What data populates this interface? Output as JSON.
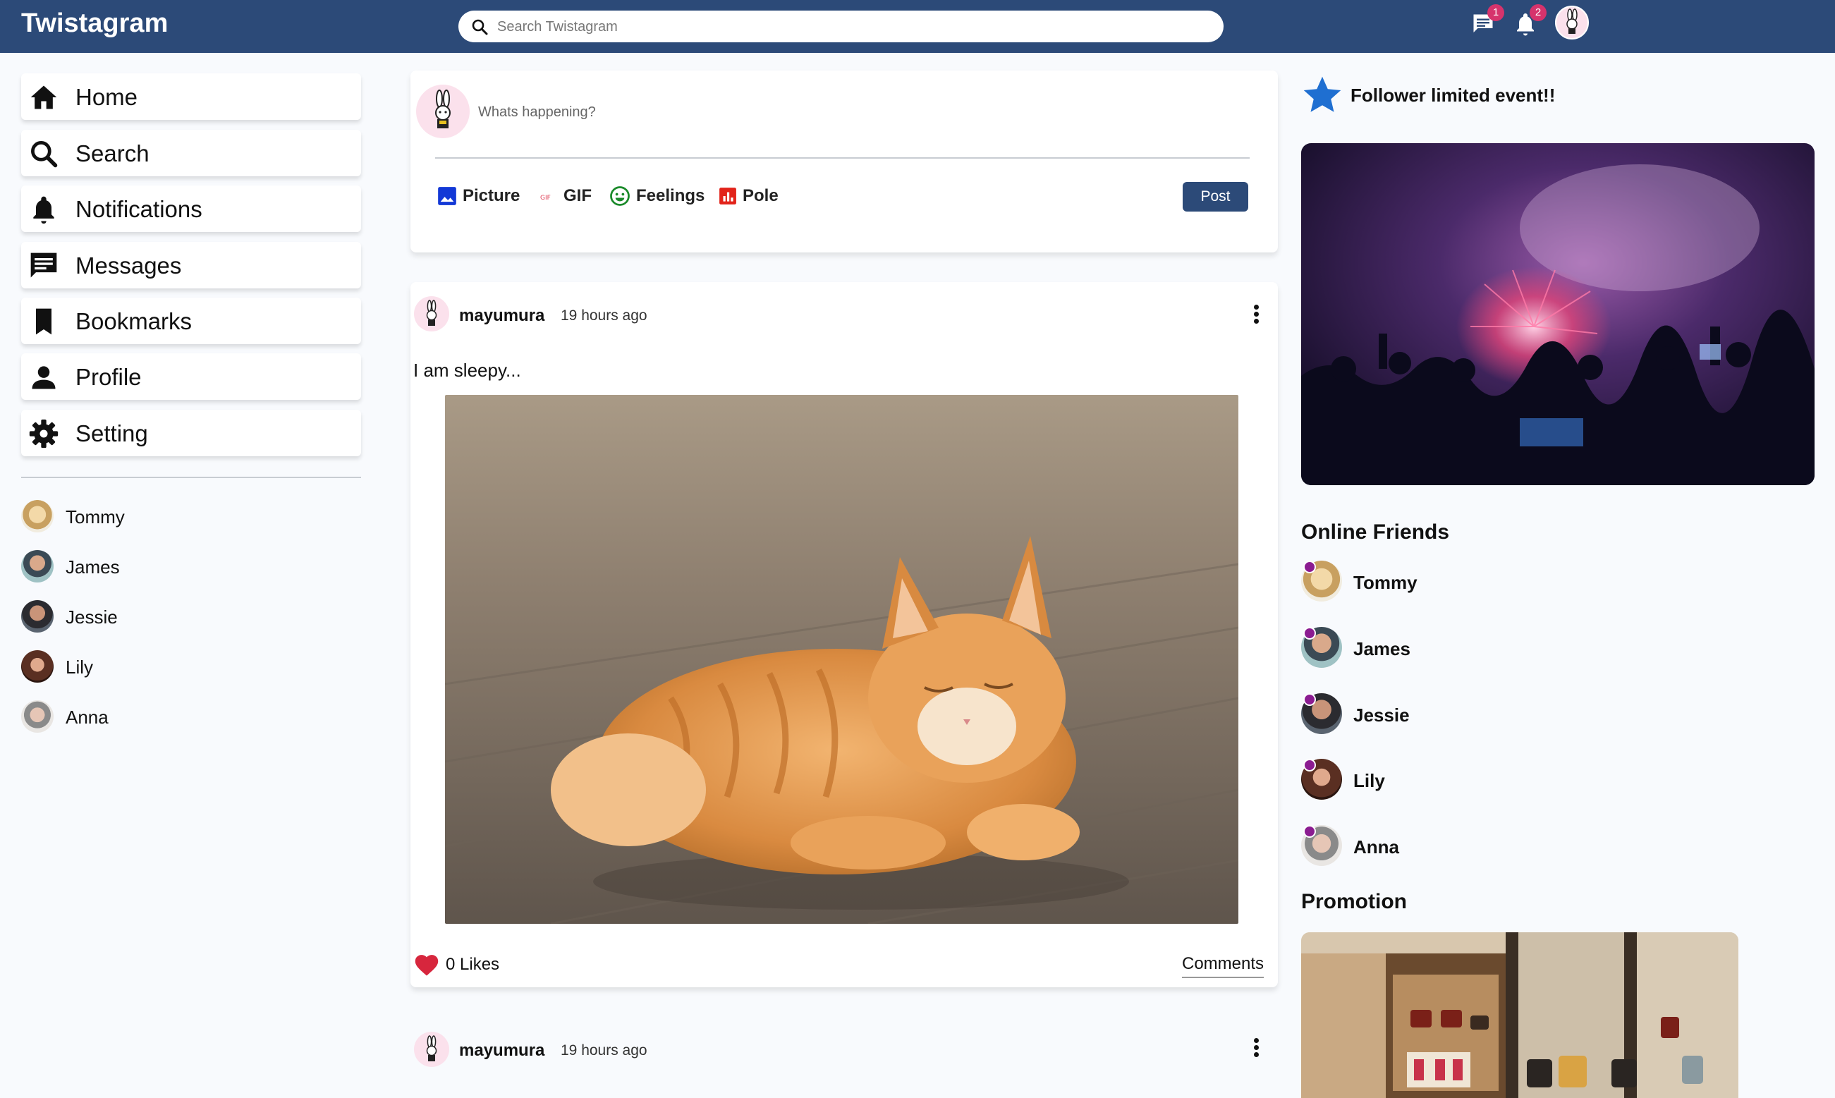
{
  "header": {
    "brand": "Twistagram",
    "search_placeholder": "Search Twistagram",
    "messages_badge": "1",
    "notifications_badge": "2",
    "bar_color": "#2c4a78",
    "badge_color": "#d6336c"
  },
  "sidebar": {
    "nav": [
      {
        "label": "Home",
        "icon": "home-icon"
      },
      {
        "label": "Search",
        "icon": "search-icon"
      },
      {
        "label": "Notifications",
        "icon": "bell-icon"
      },
      {
        "label": "Messages",
        "icon": "chat-icon"
      },
      {
        "label": "Bookmarks",
        "icon": "bookmark-icon"
      },
      {
        "label": "Profile",
        "icon": "person-icon"
      },
      {
        "label": "Setting",
        "icon": "gear-icon"
      }
    ],
    "friends": [
      "Tommy",
      "James",
      "Jessie",
      "Lily",
      "Anna"
    ]
  },
  "composer": {
    "placeholder": "Whats happening?",
    "options": [
      {
        "label": "Picture",
        "icon": "image-icon"
      },
      {
        "label": "GIF",
        "icon": "gif-icon"
      },
      {
        "label": "Feelings",
        "icon": "smiley-icon"
      },
      {
        "label": "Pole",
        "icon": "poll-icon"
      }
    ],
    "post_label": "Post"
  },
  "posts": [
    {
      "user": "mayumura",
      "time": "19 hours ago",
      "text": "I am sleepy...",
      "likes_label": "0 Likes",
      "comments_label": "Comments"
    },
    {
      "user": "mayumura",
      "time": "19 hours ago"
    }
  ],
  "right": {
    "event_title": "Follower limited event!!",
    "online_title": "Online Friends",
    "online_friends": [
      "Tommy",
      "James",
      "Jessie",
      "Lily",
      "Anna"
    ],
    "promotion_title": "Promotion",
    "online_dot_color": "#8b1c91",
    "star_color": "#1f6fd1"
  }
}
